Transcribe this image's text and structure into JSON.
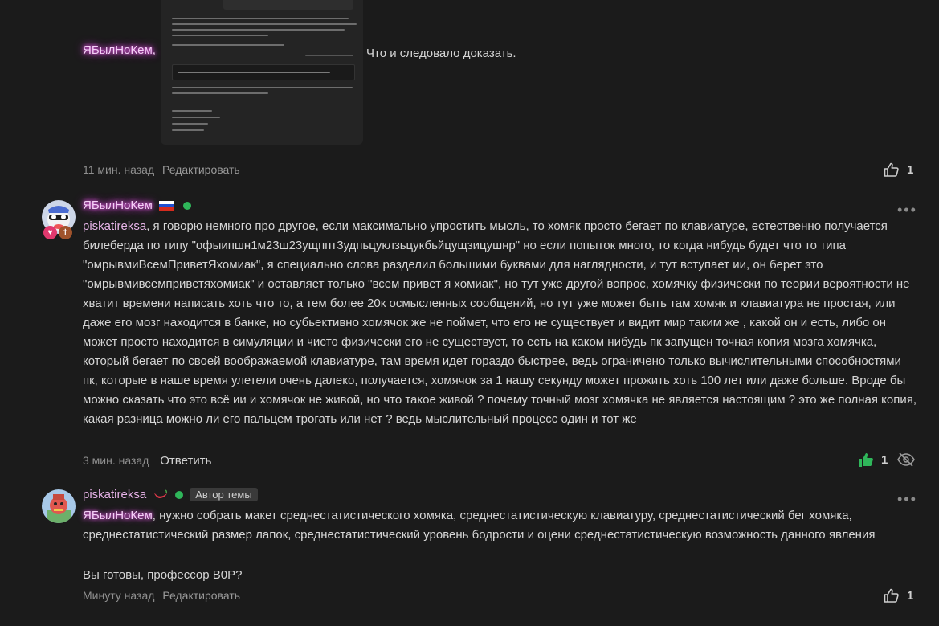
{
  "comment1": {
    "author": "ЯБылНоКем",
    "comma": ",",
    "text_after": "Что и следовало доказать.",
    "time": "11 мин. назад",
    "edit_label": "Редактировать",
    "likes": "1"
  },
  "comment2": {
    "author": "ЯБылНоКем",
    "flag_icon": "russia-flag-icon",
    "mention": "piskatireksa",
    "text": ", я говорю немного про другое, если максимально упростить мысль, то хомяк просто бегает по клавиатуре, естественно получается билеберда по типу \"офыипшн1м23ш23ущппт3удпьцуклзьцукбьйцущзицушнр\" но если попыток много, то когда нибудь будет что то типа \"омрывмиВсемПриветЯхомиак\", я специально слова разделил большими буквами для наглядности, и тут вступает ии, он берет это \"омрывмивсемприветяхомиак\" и оставляет только \"всем привет я хомиак\", но тут уже другой вопрос, хомячку физически по теории вероятности не хватит времени написать хоть что то, а тем более 20к осмысленных сообщений, но тут уже может быть там хомяк и клавиатура не простая, или даже его мозг находится в банке, но субьективно хомячок же не поймет, что его не существует и видит мир таким же , какой он и есть, либо он может просто находится в симуляции и чисто физически его не существует, то есть на каком нибудь пк запущен точная копия мозга хомячка, который бегает по своей воображаемой клавиатуре, там время идет гораздо быстрее, ведь ограничено только вычислительными способностями пк, которые в наше время улетели очень далеко, получается, хомячок за 1 нашу секунду может прожить хоть 100 лет или даже больше. Вроде бы можно сказать что это всё ии и хомячок не живой, но что такое живой ? почему точный мозг хомячка не является настоящим ? это же полная копия, какая разница можно ли его пальцем трогать или нет ? ведь мыслительный процесс один и тот же",
    "time": "3 мин. назад",
    "reply_label": "Ответить",
    "likes": "1",
    "accent": "#2fb65a"
  },
  "comment3": {
    "author": "piskatireksa",
    "topic_badge": "Автор темы",
    "mention": "ЯБылНоКем",
    "text": ", нужно собрать макет среднестатистического хомяка, среднестатистическую клавиатуру, среднестатистический бег хомяка, среднестатистический размер лапок, среднестатистический уровень бодрости и оцени среднестатистическую возможность данного явления",
    "text2": "Вы готовы, профессор B0P?",
    "time": "Минуту назад",
    "edit_label": "Редактировать",
    "likes": "1"
  },
  "colors": {
    "background": "#1b1b1b",
    "online": "#2fb65a",
    "name_glow": "#e95be8"
  }
}
